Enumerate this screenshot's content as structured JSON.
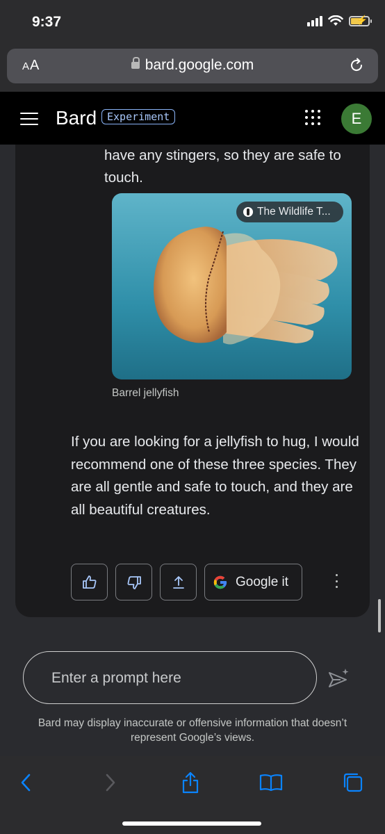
{
  "status_bar": {
    "time": "9:37"
  },
  "browser": {
    "text_size_label": "AA",
    "url": "bard.google.com"
  },
  "app_header": {
    "brand": "Bard",
    "badge": "Experiment",
    "avatar_initial": "E"
  },
  "response": {
    "text_fragment": "have any stingers, so they are safe to touch.",
    "image": {
      "source_label": "The Wildlife T...",
      "caption": "Barrel jellyfish"
    },
    "paragraph": "If you are looking for a jellyfish to hug, I would recommend one of these three species. They are all gentle and safe to touch, and they are all beautiful creatures.",
    "actions": {
      "google_it_label": "Google it"
    }
  },
  "prompt": {
    "placeholder": "Enter a prompt here"
  },
  "disclaimer": "Bard may display inaccurate or offensive information that doesn’t represent Google’s views.",
  "colors": {
    "accent": "#8ab4f8",
    "avatar": "#3b7a35",
    "background": "#2a2b2f",
    "card": "#1b1b1d",
    "safari_blue": "#0a84ff"
  },
  "icons": [
    "hamburger-icon",
    "apps-grid-icon",
    "lock-icon",
    "reload-icon",
    "thumbs-up-icon",
    "thumbs-down-icon",
    "share-icon",
    "google-g-icon",
    "more-vert-icon",
    "send-icon",
    "back-icon",
    "forward-icon",
    "safari-share-icon",
    "bookmarks-icon",
    "tabs-icon"
  ]
}
